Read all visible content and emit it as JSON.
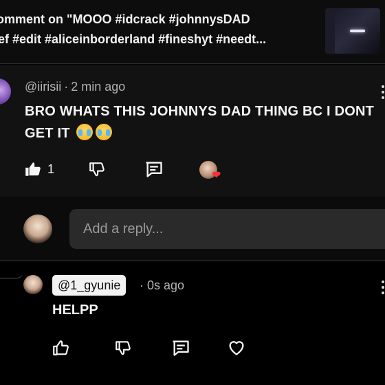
{
  "header": {
    "line1": "omment on \"MOOO #idcrack #johnnysDAD",
    "line2": "ef #edit #aliceinborderland #fineshyt #needt..."
  },
  "comment": {
    "username": "@iirisii",
    "separator": "·",
    "time": "2 min ago",
    "text": "BRO WHATS THIS JOHNNYS DAD THING BC I DONT GET IT",
    "emojis": [
      "loudly-crying-face",
      "loudly-crying-face"
    ],
    "like_count": "1",
    "icons": {
      "like": "thumbs-up-filled-icon",
      "dislike": "thumbs-down-icon",
      "reply": "comment-icon",
      "creator_heart": "creator-heart-icon",
      "more": "more-vertical-icon"
    }
  },
  "reply_box": {
    "placeholder": "Add a reply..."
  },
  "reply": {
    "handle": "@1_gyunie",
    "separator": "·",
    "time": "0s ago",
    "text": "HELPP",
    "icons": {
      "like": "thumbs-up-icon",
      "dislike": "thumbs-down-icon",
      "reply": "comment-icon",
      "heart": "heart-icon",
      "more": "more-vertical-icon"
    }
  },
  "colors": {
    "background": "#000000",
    "card": "#121212",
    "input": "#2a2a2a",
    "muted_text": "#b3b3b3",
    "heart_red": "#ff2d3a"
  }
}
